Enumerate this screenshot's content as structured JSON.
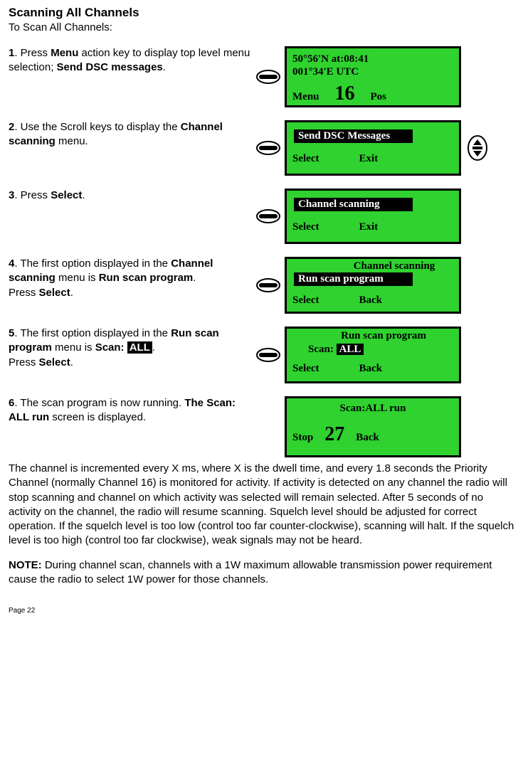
{
  "title": "Scanning All Channels",
  "subtitle": "To Scan All Channels:",
  "steps": {
    "s1": {
      "num": "1",
      "pre": ". Press ",
      "b1": "Menu",
      "mid": " action key to display top level menu selection; ",
      "b2": "Send DSC messages",
      "post": "."
    },
    "s2": {
      "num": "2",
      "pre": ". Use the Scroll keys to display the ",
      "b1": "Channel scanning",
      "post": " menu."
    },
    "s3": {
      "num": "3",
      "pre": ". Press ",
      "b1": "Select",
      "post": "."
    },
    "s4": {
      "num": "4",
      "pre": ". The first option displayed in the ",
      "b1": "Channel scanning",
      "mid": " menu is ",
      "b2": "Run scan program",
      "post1": ".",
      "line2a": "Press  ",
      "line2b": "Select",
      "line2c": "."
    },
    "s5": {
      "num": "5",
      "pre": ". The first option displayed in the ",
      "b1": "Run scan program",
      "mid": " menu is  ",
      "b2": "Scan: ",
      "inv": "ALL",
      "post": ".",
      "line2a": "Press ",
      "line2b": "Select",
      "line2c": "."
    },
    "s6": {
      "num": "6",
      "pre": ". The scan program is now running. ",
      "b1": "The Scan: ALL run",
      "post": " screen is displayed."
    }
  },
  "screens": {
    "scr1": {
      "l1": "50°56'N       at:08:41",
      "l2": "001°34'E     UTC",
      "menu": "Menu",
      "ch": "16",
      "pos": "Pos"
    },
    "scr2": {
      "hi": "Send DSC Messages",
      "left": "Select",
      "right": "Exit"
    },
    "scr3": {
      "hi": "Channel scanning",
      "left": "Select",
      "right": "Exit"
    },
    "scr4": {
      "title": "Channel scanning",
      "hi": "Run scan program",
      "left": "Select",
      "right": "Back"
    },
    "scr5": {
      "title": "Run scan program",
      "scanLabel": "Scan: ",
      "scanVal": "ALL",
      "left": "Select",
      "right": "Back"
    },
    "scr6": {
      "title": "Scan:ALL run",
      "left": "Stop",
      "ch": "27",
      "right": "Back"
    }
  },
  "para1": "The channel is incremented every X ms, where X is the dwell time, and every 1.8 seconds the Priority Channel (normally Channel 16) is monitored for activity. If activity is detected on any channel the radio will stop scanning and channel on which activity was selected will remain selected. After 5 seconds of no activity on the channel, the radio will resume scanning. Squelch level should be adjusted for correct operation. If the squelch level is too low (control too far counter-clockwise), scanning will halt. If the squelch level is too high (control too far clockwise), weak signals may not be heard.",
  "noteLabel": "NOTE:",
  "noteText": " During channel scan, channels with a 1W maximum allowable transmission power requirement cause the radio to select 1W power for those channels.",
  "pageNum": "Page 22"
}
